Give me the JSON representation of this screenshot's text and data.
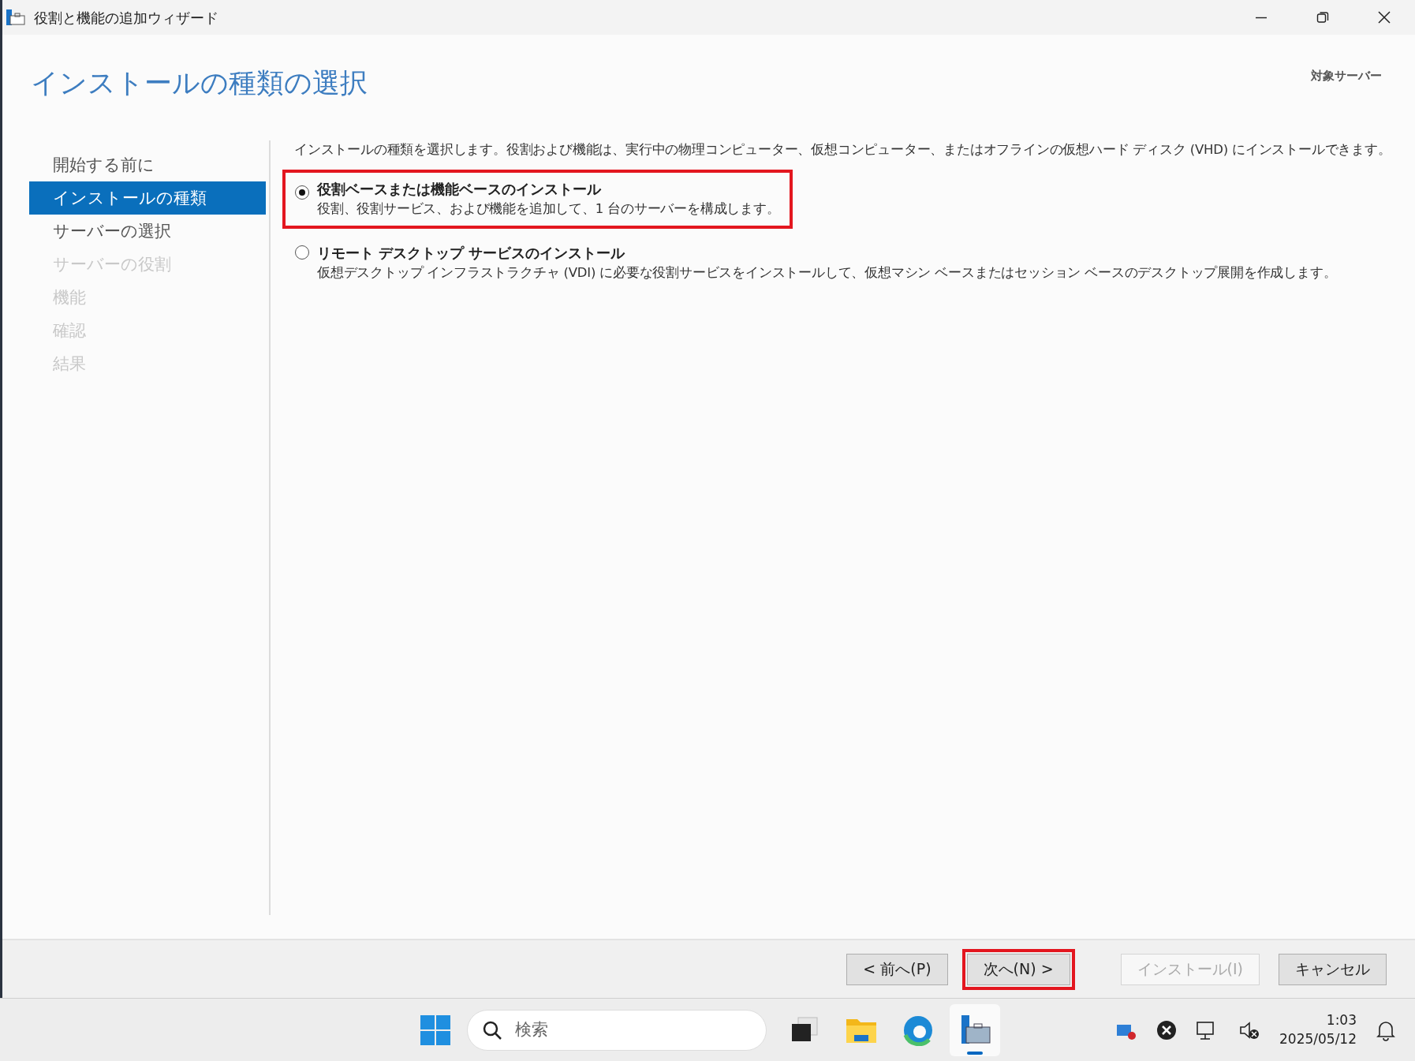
{
  "window": {
    "title": "役割と機能の追加ウィザード"
  },
  "header": {
    "title": "インストールの種類の選択",
    "target_server_label": "対象サーバー"
  },
  "steps": [
    {
      "label": "開始する前に",
      "selected": false,
      "disabled": false
    },
    {
      "label": "インストールの種類",
      "selected": true,
      "disabled": false
    },
    {
      "label": "サーバーの選択",
      "selected": false,
      "disabled": false
    },
    {
      "label": "サーバーの役割",
      "selected": false,
      "disabled": true
    },
    {
      "label": "機能",
      "selected": false,
      "disabled": true
    },
    {
      "label": "確認",
      "selected": false,
      "disabled": true
    },
    {
      "label": "結果",
      "selected": false,
      "disabled": true
    }
  ],
  "description": "インストールの種類を選択します。役割および機能は、実行中の物理コンピューター、仮想コンピューター、またはオフラインの仮想ハード ディスク (VHD) にインストールできます。",
  "options": [
    {
      "title": "役割ベースまたは機能ベースのインストール",
      "detail": "役割、役割サービス、および機能を追加して、1 台のサーバーを構成します。",
      "selected": true,
      "highlighted": true
    },
    {
      "title": "リモート デスクトップ サービスのインストール",
      "detail": "仮想デスクトップ インフラストラクチャ (VDI) に必要な役割サービスをインストールして、仮想マシン ベースまたはセッション ベースのデスクトップ展開を作成します。",
      "selected": false,
      "highlighted": false
    }
  ],
  "buttons": [
    {
      "label": "< 前へ(P)",
      "disabled": false,
      "highlighted": false
    },
    {
      "label": "次へ(N) >",
      "disabled": false,
      "highlighted": true
    },
    {
      "label": "インストール(I)",
      "disabled": true,
      "highlighted": false
    },
    {
      "label": "キャンセル",
      "disabled": false,
      "highlighted": false
    }
  ],
  "taskbar": {
    "search": {
      "placeholder": "検索"
    },
    "apps": [
      {
        "kind": "taskview",
        "active": false
      },
      {
        "kind": "folder",
        "active": false
      },
      {
        "kind": "browser",
        "active": false
      },
      {
        "kind": "server",
        "active": true
      }
    ],
    "time": "1:03",
    "date": "2025/05/12"
  }
}
